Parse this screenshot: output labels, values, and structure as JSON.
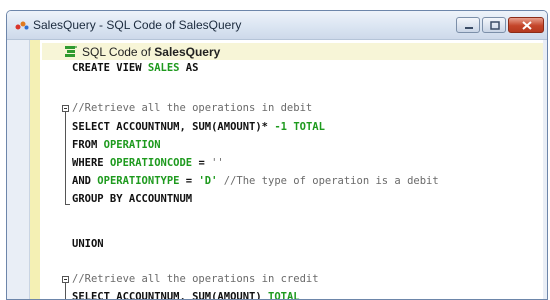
{
  "window": {
    "title": "SalesQuery - SQL Code of SalesQuery"
  },
  "editor": {
    "header_prefix": "SQL Code of ",
    "header_name": "SalesQuery",
    "lines": {
      "create": {
        "kw": "CREATE VIEW",
        "id": "SALES",
        "tail": " AS"
      },
      "comment1": "//Retrieve all the operations in debit",
      "select1": {
        "kw": "SELECT",
        "a": " ACCOUNTNUM, ",
        "fn": "SUM",
        "b": "(",
        "arg": "AMOUNT",
        "c": ")* ",
        "num": "-1",
        "d": " ",
        "alias": "TOTAL"
      },
      "from1": {
        "kw": "FROM",
        "id": "OPERATION"
      },
      "where1": {
        "kw": "WHERE",
        "id": "OPERATIONCODE",
        "tail": " = ",
        "str": "''"
      },
      "and1": {
        "kw": "AND",
        "id": "OPERATIONTYPE",
        "tail": " = ",
        "str": "'D'",
        "comment": " //The type of operation is a debit"
      },
      "group1": {
        "kw": "GROUP BY",
        "tail": " ACCOUNTNUM"
      },
      "union": "UNION",
      "comment2": "//Retrieve all the operations in credit",
      "select2": {
        "kw": "SELECT",
        "a": " ACCOUNTNUM, ",
        "fn": "SUM",
        "b": "(",
        "arg": "AMOUNT",
        "c": ") ",
        "alias": "TOTAL"
      }
    }
  }
}
